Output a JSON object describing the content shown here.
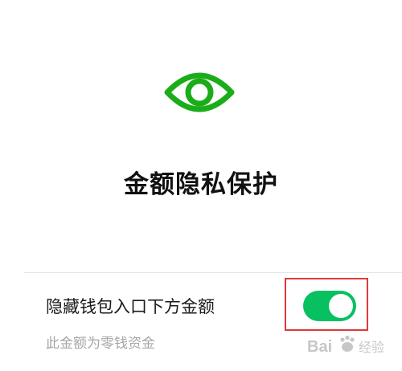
{
  "title": "金额隐私保护",
  "setting": {
    "label": "隐藏钱包入口下方金额",
    "description": "此金额为零钱资金",
    "enabled": true
  },
  "icons": {
    "main": "eye-icon"
  },
  "colors": {
    "accent": "#07c160",
    "highlight": "#e03a3a"
  },
  "watermark": {
    "brand": "Bai",
    "suffix": "经验"
  }
}
